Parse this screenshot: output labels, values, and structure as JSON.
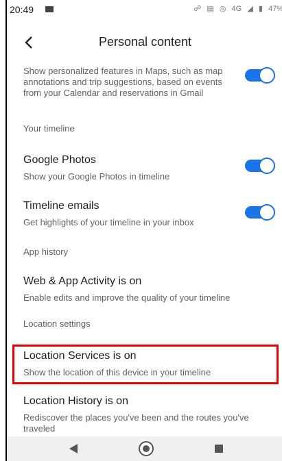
{
  "status": {
    "time": "20:49",
    "network": "4G",
    "battery": "47%"
  },
  "header": {
    "title": "Personal content"
  },
  "items": {
    "maps_features": {
      "subtitle": "Show personalized features in Maps, such as map annotations and trip suggestions, based on events from your Calendar and reservations in Gmail",
      "enabled": true
    },
    "section_timeline": "Your timeline",
    "google_photos": {
      "title": "Google Photos",
      "subtitle": "Show your Google Photos in timeline",
      "enabled": true
    },
    "timeline_emails": {
      "title": "Timeline emails",
      "subtitle": "Get highlights of your timeline in your inbox",
      "enabled": true
    },
    "section_app_history": "App history",
    "web_app_activity": {
      "title": "Web & App Activity is on",
      "subtitle": "Enable edits and improve the quality of your timeline"
    },
    "section_location": "Location settings",
    "location_services": {
      "title": "Location Services is on",
      "subtitle": "Show the location of this device in your timeline"
    },
    "location_history": {
      "title": "Location History is on",
      "subtitle": "Rediscover the places you've been and the routes you've traveled"
    }
  },
  "colors": {
    "accent": "#1a73e8",
    "highlight": "#e60000"
  },
  "icons": {
    "back": "arrow-back-icon",
    "nav_back": "triangle-back-icon",
    "nav_home": "circle-home-icon",
    "nav_recent": "square-recent-icon"
  }
}
